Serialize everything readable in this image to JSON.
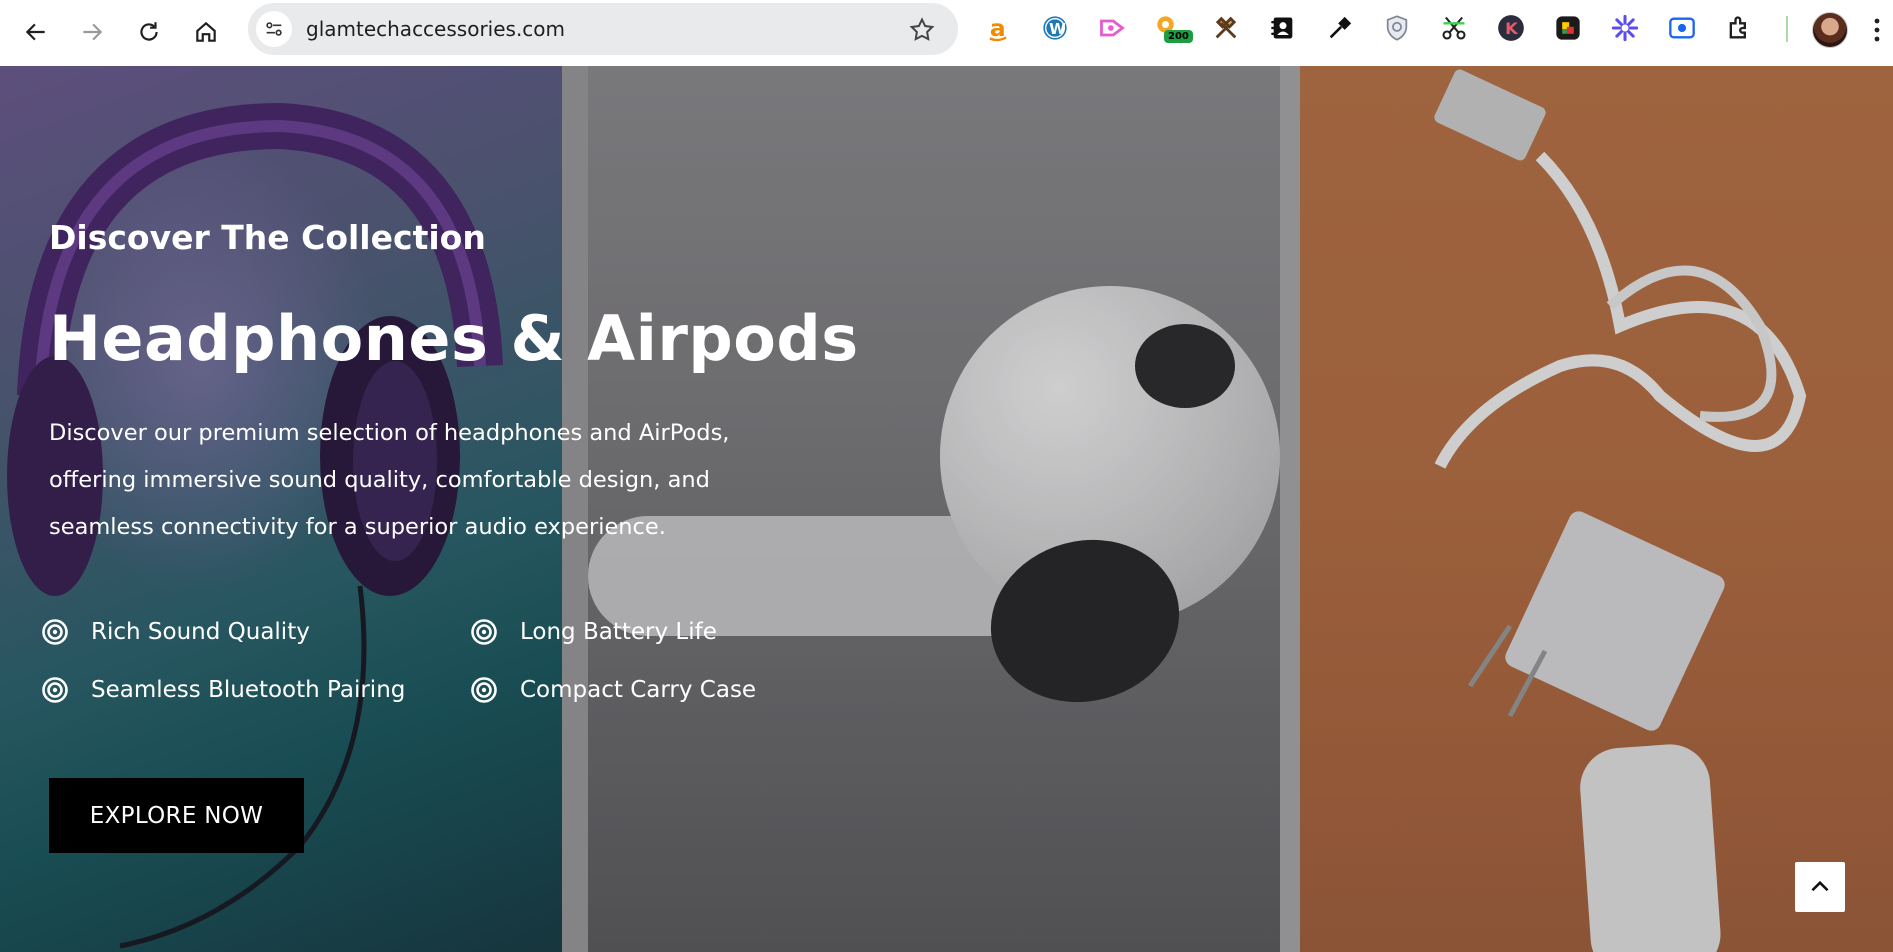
{
  "browser": {
    "url": "glamtechaccessories.com",
    "nav_icons": [
      "back-arrow-icon",
      "forward-arrow-icon",
      "reload-icon",
      "home-icon"
    ],
    "extensions": [
      "amazon-extension-icon",
      "wordpress-extension-icon",
      "pink-arrow-extension-icon",
      "badge-extension-icon",
      "tools-extension-icon",
      "contacts-extension-icon",
      "eyedropper-extension-icon",
      "shield-extension-icon",
      "scissors-extension-icon",
      "k-extension-icon",
      "color-extension-icon",
      "asterisk-extension-icon",
      "screen-record-extension-icon",
      "puzzle-extensions-icon"
    ],
    "extension_badge": "200"
  },
  "hero": {
    "subtitle": "Discover The Collection",
    "title": "Headphones & Airpods",
    "description": "Discover our premium selection of headphones and AirPods, offering immersive sound quality, comfortable design, and seamless connectivity for a superior audio experience.",
    "features": [
      "Rich Sound Quality",
      "Long Battery Life",
      "Seamless Bluetooth Pairing",
      "Compact Carry Case"
    ],
    "cta_label": "EXPLORE NOW"
  },
  "colors": {
    "cta_background": "#000000",
    "hero_text": "#ffffff",
    "right_panel": "#b8754a"
  }
}
